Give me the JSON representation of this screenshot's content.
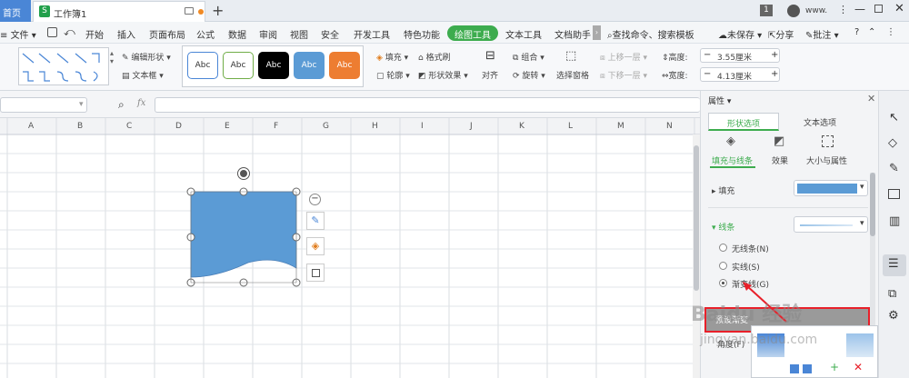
{
  "tabs": {
    "home": "首页",
    "doc": "工作簿1",
    "add": "+",
    "count": "1",
    "account": "www."
  },
  "menu": {
    "file": "文件",
    "items": [
      "开始",
      "插入",
      "页面布局",
      "公式",
      "数据",
      "审阅",
      "视图",
      "安全",
      "开发工具",
      "特色功能"
    ],
    "active": "绘图工具",
    "text_tool": "文本工具",
    "doc_helper": "文档助手",
    "search": "查找命令、搜索模板",
    "unsaved": "未保存",
    "share": "分享",
    "annotate": "批注",
    "help": "?"
  },
  "ribbon": {
    "edit_shape": "编辑形状",
    "textbox": "文本框",
    "style_label": "Abc",
    "fill": "填充",
    "outline": "轮廓",
    "format_brush": "格式刷",
    "shape_effect": "形状效果",
    "align": "对齐",
    "group": "组合",
    "rotate": "旋转",
    "selection_pane": "选择窗格",
    "bring_forward": "上移一层",
    "send_backward": "下移一层",
    "height_label": "高度:",
    "height_value": "3.55厘米",
    "width_label": "宽度:",
    "width_value": "4.13厘米",
    "minus": "−",
    "plus": "+"
  },
  "formula": {
    "fx": "fx"
  },
  "columns": [
    "A",
    "B",
    "C",
    "D",
    "E",
    "F",
    "G",
    "H",
    "I",
    "J",
    "K",
    "L",
    "M",
    "N"
  ],
  "panel": {
    "title": "属性",
    "tab_shape": "形状选项",
    "tab_text": "文本选项",
    "sub_fill": "填充与线条",
    "sub_effect": "效果",
    "sub_size": "大小与属性",
    "fill_label": "填充",
    "line_label": "线条",
    "opt_none": "无线条(N)",
    "opt_solid": "实线(S)",
    "opt_gradient": "渐变线(G)",
    "preset_label": "预设渐变",
    "angle_label": "角度(F)"
  },
  "watermark": {
    "line1": "Baidu 经验",
    "line2": "jingyan.baidu.com"
  },
  "colors": {
    "accent_green": "#3dac4e",
    "shape_fill": "#5b9bd5",
    "highlight_red": "#e8202a",
    "tab_blue": "#4a86d6"
  }
}
